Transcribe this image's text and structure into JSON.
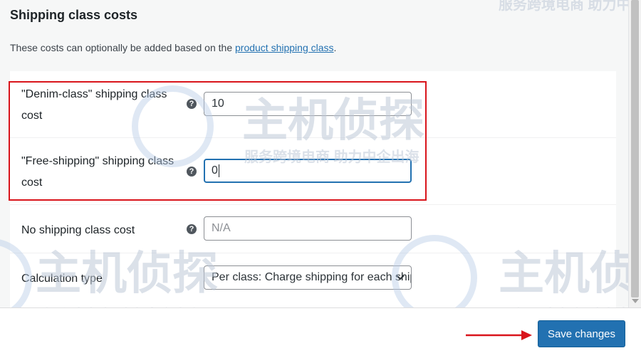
{
  "section": {
    "title": "Shipping class costs",
    "description_text": "These costs can optionally be added based on the",
    "description_link": "product shipping class",
    "description_end": "."
  },
  "help_icon_glyph": "?",
  "rows": [
    {
      "label": "\"Denim-class\" shipping class cost",
      "value": "10",
      "placeholder": "",
      "focused": false
    },
    {
      "label": "\"Free-shipping\" shipping class cost",
      "value": "0",
      "placeholder": "",
      "focused": true
    },
    {
      "label": "No shipping class cost",
      "value": "",
      "placeholder": "N/A",
      "focused": false
    },
    {
      "label": "Calculation type",
      "selected": "Per class: Charge shipping for each shipping class individually"
    }
  ],
  "footer": {
    "save_label": "Save changes"
  },
  "watermark": {
    "brand": "主机侦探",
    "slogan": "服务跨境电商 助力中企出海"
  },
  "colors": {
    "accent": "#2271b1",
    "highlight": "#d9141b",
    "arrow": "#d9141b"
  },
  "icons": [
    "question-mark-icon",
    "chevron-down-icon",
    "arrow-right-icon"
  ]
}
